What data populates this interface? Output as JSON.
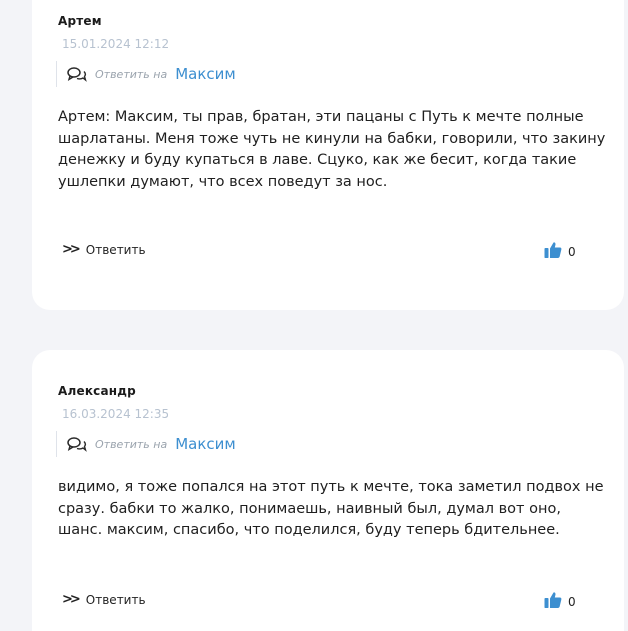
{
  "comments": [
    {
      "author": "Артем",
      "date": "15.01.2024 12:12",
      "reply_to_label": "Ответить на",
      "reply_to_name": "Максим",
      "text": "Артем: Максим, ты прав, братан, эти пацаны с Путь к мечте полные шарлатаны. Меня тоже чуть не кинули на бабки, говорили, что закину денежку и буду купаться в лаве. Сцуко, как же бесит, когда такие ушлепки думают, что всех поведут за нос.",
      "reply_button": "Ответить",
      "likes": "0"
    },
    {
      "author": "Александр",
      "date": "16.03.2024 12:35",
      "reply_to_label": "Ответить на",
      "reply_to_name": "Максим",
      "text": "видимо, я тоже попался на этот путь к мечте, тока заметил подвох не сразу. бабки то жалко, понимаешь, наивный был, думал вот оно, шанс. максим, спасибо, что поделился, буду теперь бдительнее.",
      "reply_button": "Ответить",
      "likes": "0"
    }
  ],
  "icons": {
    "reply_to": "chat-bubbles-icon",
    "reply_button": "double-chevron-right-icon",
    "like": "thumbs-up-icon"
  },
  "colors": {
    "background": "#f3f4f8",
    "card": "#ffffff",
    "accent": "#3d8fd0",
    "date": "#b7c2d0",
    "like_icon": "#3d8fd0"
  }
}
